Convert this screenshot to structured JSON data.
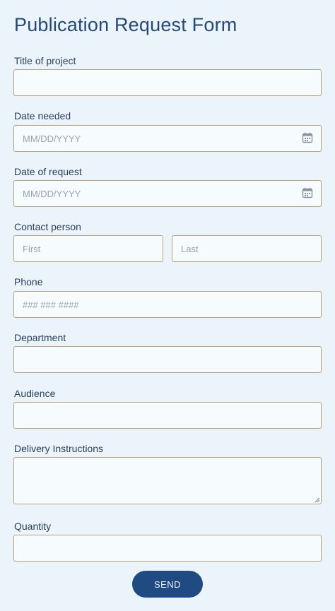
{
  "form": {
    "title": "Publication Request Form",
    "fields": {
      "title_of_project": {
        "label": "Title of project",
        "value": "",
        "placeholder": ""
      },
      "date_needed": {
        "label": "Date needed",
        "value": "",
        "placeholder": "MM/DD/YYYY",
        "icon": "calendar-icon"
      },
      "date_of_request": {
        "label": "Date of request",
        "value": "",
        "placeholder": "MM/DD/YYYY",
        "icon": "calendar-icon"
      },
      "contact_person": {
        "label": "Contact person",
        "first": {
          "value": "",
          "placeholder": "First"
        },
        "last": {
          "value": "",
          "placeholder": "Last"
        }
      },
      "phone": {
        "label": "Phone",
        "value": "",
        "placeholder": "### ### ####"
      },
      "department": {
        "label": "Department",
        "value": "",
        "placeholder": ""
      },
      "audience": {
        "label": "Audience",
        "value": "",
        "placeholder": ""
      },
      "delivery_instructions": {
        "label": "Delivery Instructions",
        "value": "",
        "placeholder": ""
      },
      "quantity": {
        "label": "Quantity",
        "value": "",
        "placeholder": ""
      }
    },
    "submit_label": "SEND"
  },
  "colors": {
    "background": "#eaf4fa",
    "title": "#254a7a",
    "field_border": "#b7a37b",
    "button": "#1f4a82"
  }
}
